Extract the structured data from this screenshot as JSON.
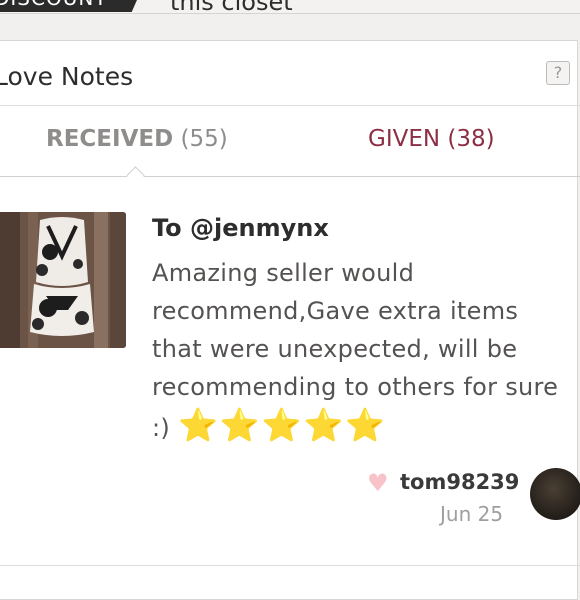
{
  "topbar": {
    "discount_tab": "DISCOUNT",
    "closet_text": "this closet"
  },
  "section": {
    "title": "Love Notes",
    "help_label": "?"
  },
  "tabs": {
    "received": {
      "label": "RECEIVED",
      "count": "(55)"
    },
    "given": {
      "label": "GIVEN",
      "count": "(38)"
    }
  },
  "note": {
    "to": "To @jenmynx",
    "body": "Amazing seller would recommend,Gave extra items that were unexpected, will be recommending to others for sure :)",
    "stars": "⭐⭐⭐⭐⭐",
    "author": "tom98239",
    "date": "Jun 25"
  },
  "colors": {
    "accent": "#8c2f45",
    "heart": "#f7c3c9",
    "star": "#f2c61f"
  }
}
